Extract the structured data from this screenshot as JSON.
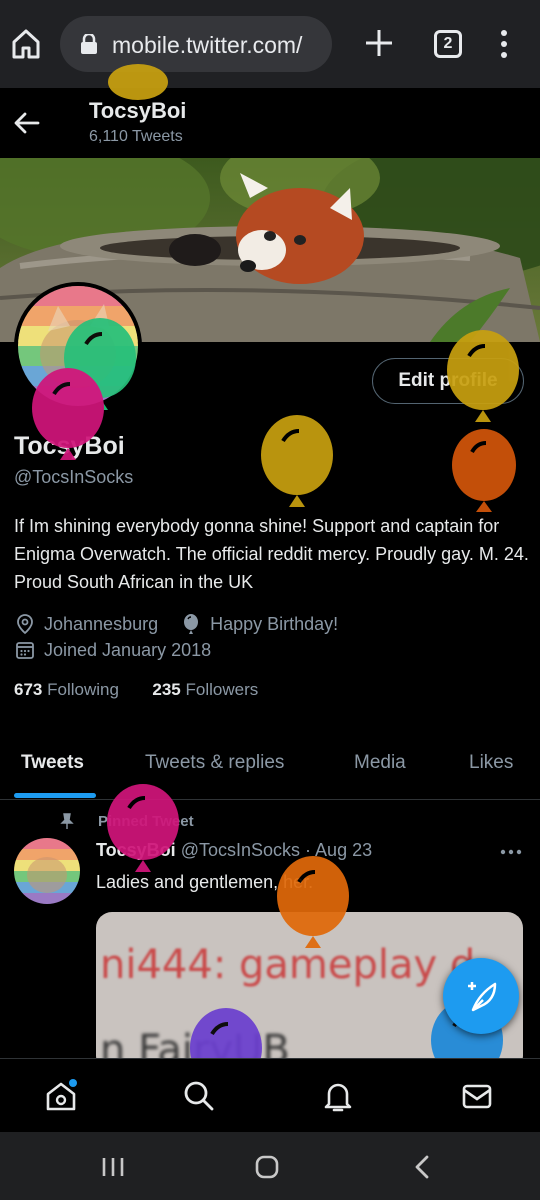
{
  "browser": {
    "url": "mobile.twitter.com/",
    "tab_count": "2"
  },
  "header": {
    "name": "TocsyBoi",
    "tweet_count": "6,110 Tweets"
  },
  "profile": {
    "edit_label": "Edit profile",
    "name": "TocsyBoi",
    "handle": "@TocsInSocks",
    "bio": "If Im shining everybody gonna shine! Support and captain for Enigma Overwatch. The official reddit mercy. Proudly gay. M. 24. Proud South African in the UK",
    "location": "Johannesburg",
    "birthday": "Happy Birthday!",
    "joined": "Joined January 2018",
    "following_count": "673",
    "following_label": "Following",
    "followers_count": "235",
    "followers_label": "Followers"
  },
  "tabs": [
    {
      "label": "Tweets",
      "active": true
    },
    {
      "label": "Tweets & replies",
      "active": false
    },
    {
      "label": "Media",
      "active": false
    },
    {
      "label": "Likes",
      "active": false
    }
  ],
  "tweet": {
    "pinned_label": "Pinned Tweet",
    "name": "TocsyBoi",
    "handle": "@TocsInSocks",
    "sep": "·",
    "date": "Aug 23",
    "text": "Ladies and gentlemen, her.",
    "media_line1_name": "ni444",
    "media_line1_rest": ": gameplay d",
    "media_line2": "n FairyUB"
  },
  "colors": {
    "accent": "#1d9bf0",
    "background": "#000000",
    "secondary_text": "#8b98a5"
  }
}
